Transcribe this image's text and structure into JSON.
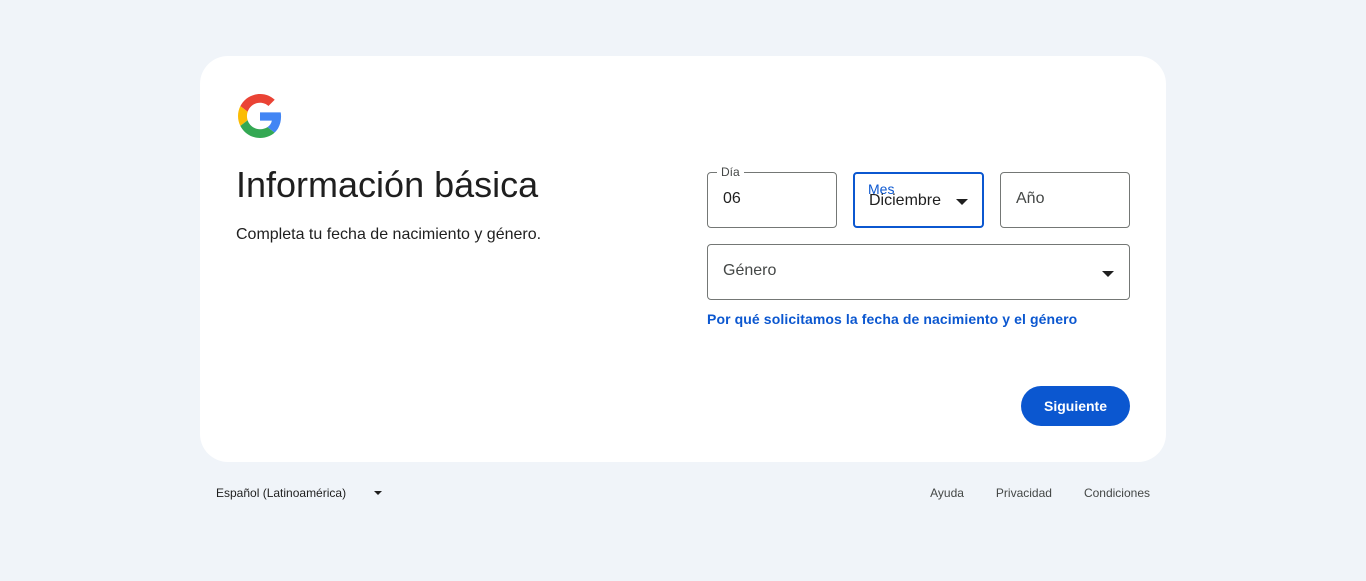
{
  "logo": {
    "icon": "google-g-icon"
  },
  "heading": {
    "title": "Información básica",
    "subtitle": "Completa tu fecha de nacimiento y género."
  },
  "form": {
    "day": {
      "label": "Día",
      "value": "06"
    },
    "month": {
      "label": "Mes",
      "value": "Diciembre"
    },
    "year": {
      "placeholder": "Año"
    },
    "gender": {
      "placeholder": "Género"
    },
    "why_link": "Por qué solicitamos la fecha de nacimiento y el género",
    "next_button": "Siguiente"
  },
  "footer": {
    "language": "Español (Latinoamérica)",
    "links": [
      "Ayuda",
      "Privacidad",
      "Condiciones"
    ]
  },
  "colors": {
    "accent": "#0b57d0",
    "background": "#f0f4f9",
    "card": "#ffffff",
    "google_blue": "#4285f4",
    "google_red": "#ea4335",
    "google_yellow": "#fbbc05",
    "google_green": "#34a853"
  }
}
